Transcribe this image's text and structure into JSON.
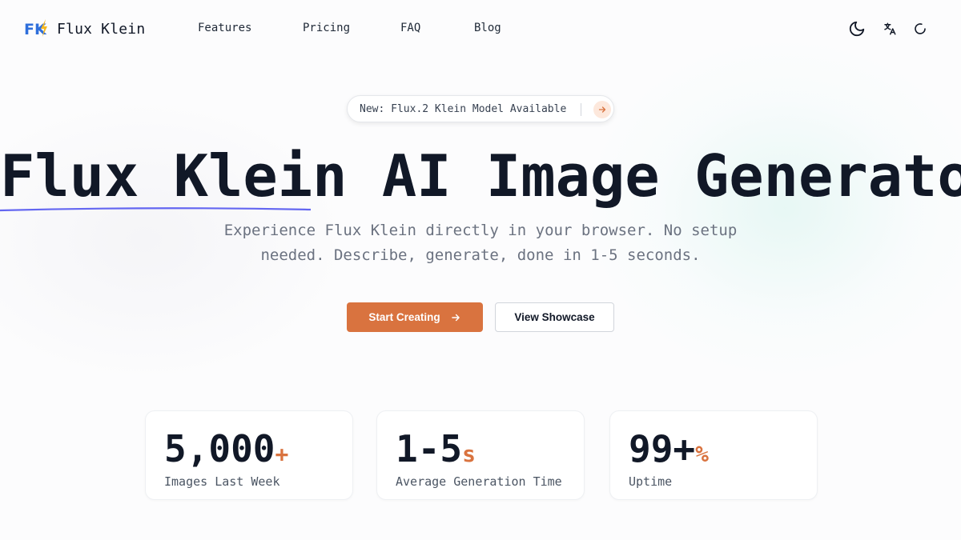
{
  "nav": {
    "logo_text": "Flux Klein",
    "links": [
      {
        "label": "Features"
      },
      {
        "label": "Pricing"
      },
      {
        "label": "FAQ"
      },
      {
        "label": "Blog"
      }
    ],
    "icons": [
      "moon-icon",
      "translate-icon",
      "loading-spinner-icon"
    ]
  },
  "hero": {
    "badge_text": "New: Flux.2 Klein Model Available",
    "title_highlight": "Flux Klein",
    "title_rest": " AI Image Generator",
    "subtitle": "Experience Flux Klein directly in your browser. No setup needed. Describe, generate, done in 1-5 seconds.",
    "primary_button": "Start Creating",
    "secondary_button": "View Showcase"
  },
  "stats": [
    {
      "value": "5,000",
      "suffix": "+",
      "label": "Images Last Week"
    },
    {
      "value": "1-5",
      "suffix": "s",
      "label": "Average Generation Time"
    },
    {
      "value": "99+",
      "suffix": "%",
      "label": "Uptime"
    }
  ],
  "colors": {
    "accent": "#d9733f",
    "brand_blue": "#2f6fdb",
    "underline": "#6366f1",
    "text": "#111827"
  }
}
